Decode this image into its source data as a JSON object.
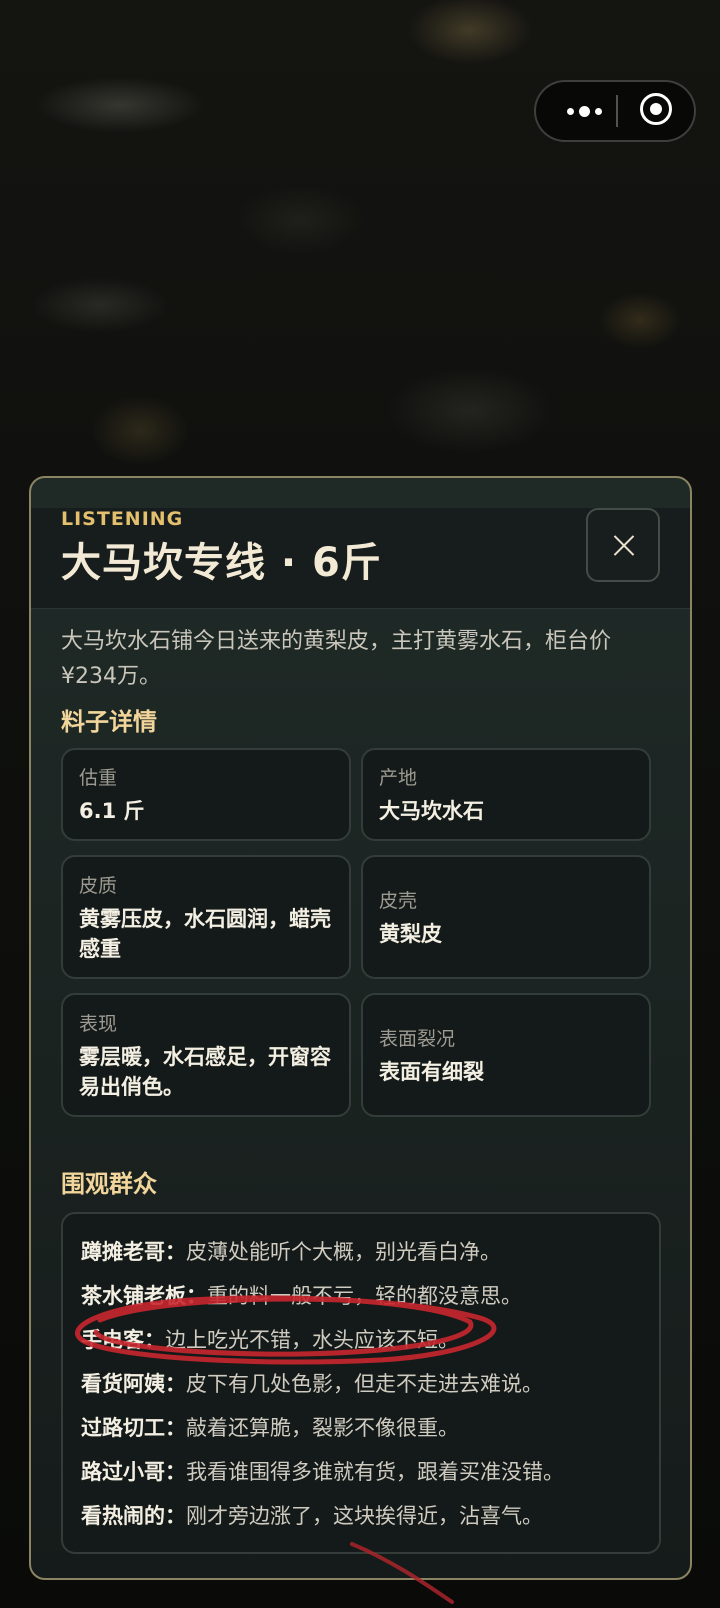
{
  "capsule": {
    "more_icon": "more-dots-icon",
    "close_icon": "target-circle-icon"
  },
  "panel": {
    "kicker": "LISTENING",
    "title": "大马坎专线 · 6斤",
    "close_icon": "close-x-icon",
    "intro": "大马坎水石铺今日送来的黄梨皮，主打黄雾水石，柜台价¥234万。",
    "details_title": "料子详情",
    "details": [
      {
        "label": "估重",
        "value": "6.1 斤"
      },
      {
        "label": "产地",
        "value": "大马坎水石"
      },
      {
        "label": "皮质",
        "value": "黄雾压皮，水石圆润，蜡壳感重"
      },
      {
        "label": "皮壳",
        "value": "黄梨皮"
      },
      {
        "label": "表现",
        "value": "雾层暖，水石感足，开窗容易出俏色。"
      },
      {
        "label": "表面裂况",
        "value": "表面有细裂"
      }
    ],
    "crowd_title": "围观群众",
    "crowd": [
      {
        "who": "蹲摊老哥：",
        "says": "皮薄处能听个大概，别光看白净。"
      },
      {
        "who": "茶水铺老板：",
        "says": "重的料一般不亏，轻的都没意思。"
      },
      {
        "who": "手电客：",
        "says": "边上吃光不错，水头应该不短。"
      },
      {
        "who": "看货阿姨：",
        "says": "皮下有几处色影，但走不走进去难说。"
      },
      {
        "who": "过路切工：",
        "says": "敲着还算脆，裂影不像很重。"
      },
      {
        "who": "路过小哥：",
        "says": "我看谁围得多谁就有货，跟着买准没错。"
      },
      {
        "who": "看热闹的：",
        "says": "刚才旁边涨了，这块挨得近，沾喜气。"
      }
    ]
  }
}
